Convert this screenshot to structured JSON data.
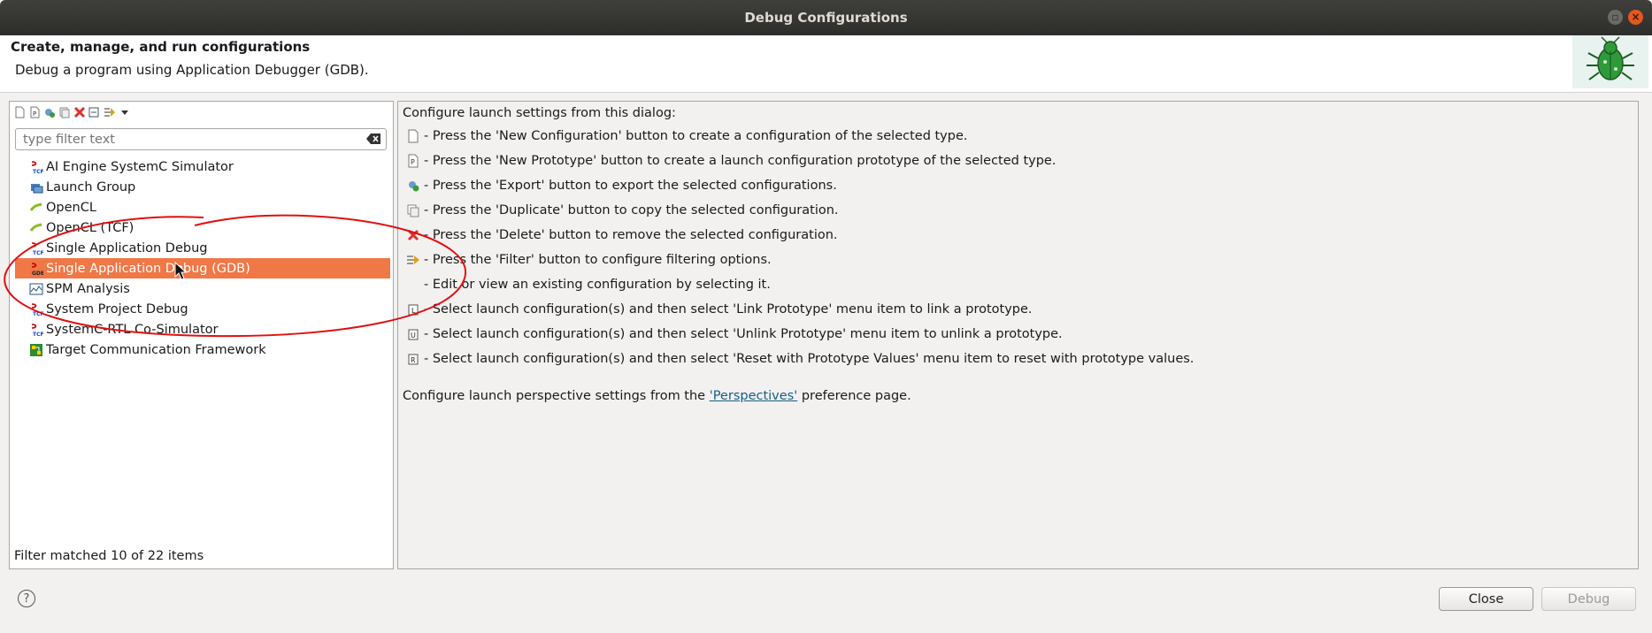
{
  "window": {
    "title": "Debug Configurations"
  },
  "header": {
    "title": "Create, manage, and run configurations",
    "subtitle": "Debug a program using Application Debugger (GDB)."
  },
  "filter": {
    "placeholder": "type filter text",
    "value": ""
  },
  "tree": {
    "items": [
      {
        "label": "AI Engine SystemC Simulator",
        "icon": "tcf-icon"
      },
      {
        "label": "Launch Group",
        "icon": "launch-group-icon"
      },
      {
        "label": "OpenCL",
        "icon": "opencl-icon"
      },
      {
        "label": "OpenCL (TCF)",
        "icon": "opencl-icon"
      },
      {
        "label": "Single Application Debug",
        "icon": "tcf-icon"
      },
      {
        "label": "Single Application Debug (GDB)",
        "icon": "gdb-icon",
        "selected": true
      },
      {
        "label": "SPM Analysis",
        "icon": "spm-icon"
      },
      {
        "label": "System Project Debug",
        "icon": "tcf-icon"
      },
      {
        "label": "SystemC-RTL Co-Simulator",
        "icon": "tcf-icon"
      },
      {
        "label": "Target Communication Framework",
        "icon": "tcf-framework-icon"
      }
    ],
    "status": "Filter matched 10 of 22 items"
  },
  "info": {
    "intro": "Configure launch settings from this dialog:",
    "rows": [
      {
        "icon": "new-config-icon",
        "text": "- Press the 'New Configuration' button to create a configuration of the selected type."
      },
      {
        "icon": "new-prototype-icon",
        "text": "- Press the 'New Prototype' button to create a launch configuration prototype of the selected type."
      },
      {
        "icon": "export-icon",
        "text": "- Press the 'Export' button to export the selected configurations."
      },
      {
        "icon": "duplicate-icon",
        "text": "- Press the 'Duplicate' button to copy the selected configuration."
      },
      {
        "icon": "delete-icon",
        "text": "- Press the 'Delete' button to remove the selected configuration."
      },
      {
        "icon": "filter-icon",
        "text": "- Press the 'Filter' button to configure filtering options."
      },
      {
        "icon": "",
        "text": "- Edit or view an existing configuration by selecting it."
      },
      {
        "icon": "link-prototype-icon",
        "text": "- Select launch configuration(s) and then select 'Link Prototype' menu item to link a prototype."
      },
      {
        "icon": "unlink-prototype-icon",
        "text": "- Select launch configuration(s) and then select 'Unlink Prototype' menu item to unlink a prototype."
      },
      {
        "icon": "reset-prototype-icon",
        "text": "- Select launch configuration(s) and then select 'Reset with Prototype Values' menu item to reset with prototype values."
      }
    ],
    "persp_before": "Configure launch perspective settings from the ",
    "persp_link": "'Perspectives'",
    "persp_after": " preference page."
  },
  "buttons": {
    "help": "?",
    "close": "Close",
    "debug": "Debug"
  },
  "colors": {
    "selection": "#f07746",
    "annotation": "#e01010",
    "link": "#135e87"
  }
}
